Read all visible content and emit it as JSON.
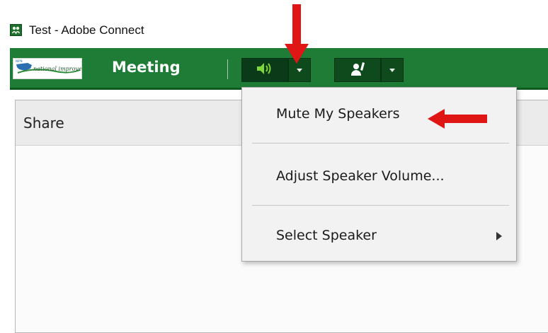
{
  "window": {
    "title": "Test - Adobe Connect"
  },
  "menubar": {
    "logo_text": "national improvement",
    "meeting_label": "Meeting"
  },
  "panel": {
    "title": "Share"
  },
  "speaker_menu": {
    "items": [
      {
        "label": "Mute My Speakers"
      },
      {
        "label": "Adjust Speaker Volume..."
      },
      {
        "label": "Select Speaker"
      }
    ]
  },
  "colors": {
    "menubar": "#1e7c36",
    "speaker_icon": "#7dd63a",
    "annotation_arrow": "#e01616"
  },
  "icons": [
    "adobe-connect-app-icon",
    "speaker-icon",
    "dropdown-caret-icon",
    "raise-hand-icon",
    "submenu-arrow-icon"
  ]
}
